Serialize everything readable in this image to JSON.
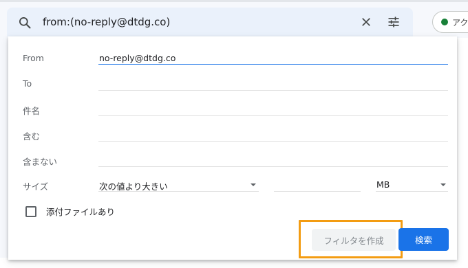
{
  "search": {
    "query": "from:(no-reply@dtdg.co)"
  },
  "status_chip": {
    "label": "アク",
    "color": "#188038"
  },
  "form": {
    "from_label": "From",
    "from_value": "no-reply@dtdg.co",
    "to_label": "To",
    "subject_label": "件名",
    "has_words_label": "含む",
    "no_words_label": "含まない",
    "size_label": "サイズ",
    "size_operator": "次の値より大きい",
    "size_value": "",
    "size_unit": "MB",
    "attachment_label": "添付ファイルあり",
    "attachment_checked": false
  },
  "actions": {
    "create_filter_label": "フィルタを作成",
    "search_label": "検索"
  },
  "colors": {
    "accent": "#1a73e8",
    "highlight": "#f39c12"
  }
}
